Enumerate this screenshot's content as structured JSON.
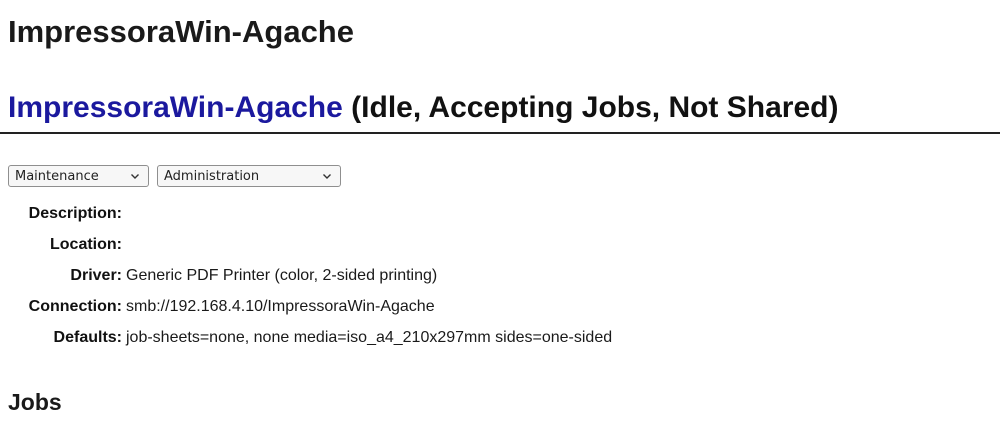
{
  "page": {
    "title": "ImpressoraWin-Agache"
  },
  "printer": {
    "name": "ImpressoraWin-Agache",
    "status": "(Idle, Accepting Jobs, Not Shared)"
  },
  "controls": {
    "maintenance_select": "Maintenance",
    "administration_select": "Administration"
  },
  "details": [
    {
      "label": "Description:",
      "value": ""
    },
    {
      "label": "Location:",
      "value": ""
    },
    {
      "label": "Driver:",
      "value": "Generic PDF Printer (color, 2-sided printing)"
    },
    {
      "label": "Connection:",
      "value": "smb://192.168.4.10/ImpressoraWin-Agache"
    },
    {
      "label": "Defaults:",
      "value": "job-sheets=none, none media=iso_a4_210x297mm sides=one-sided"
    }
  ],
  "jobs": {
    "heading": "Jobs"
  },
  "icons": {
    "select_arrow": "chevron-down-icon"
  }
}
